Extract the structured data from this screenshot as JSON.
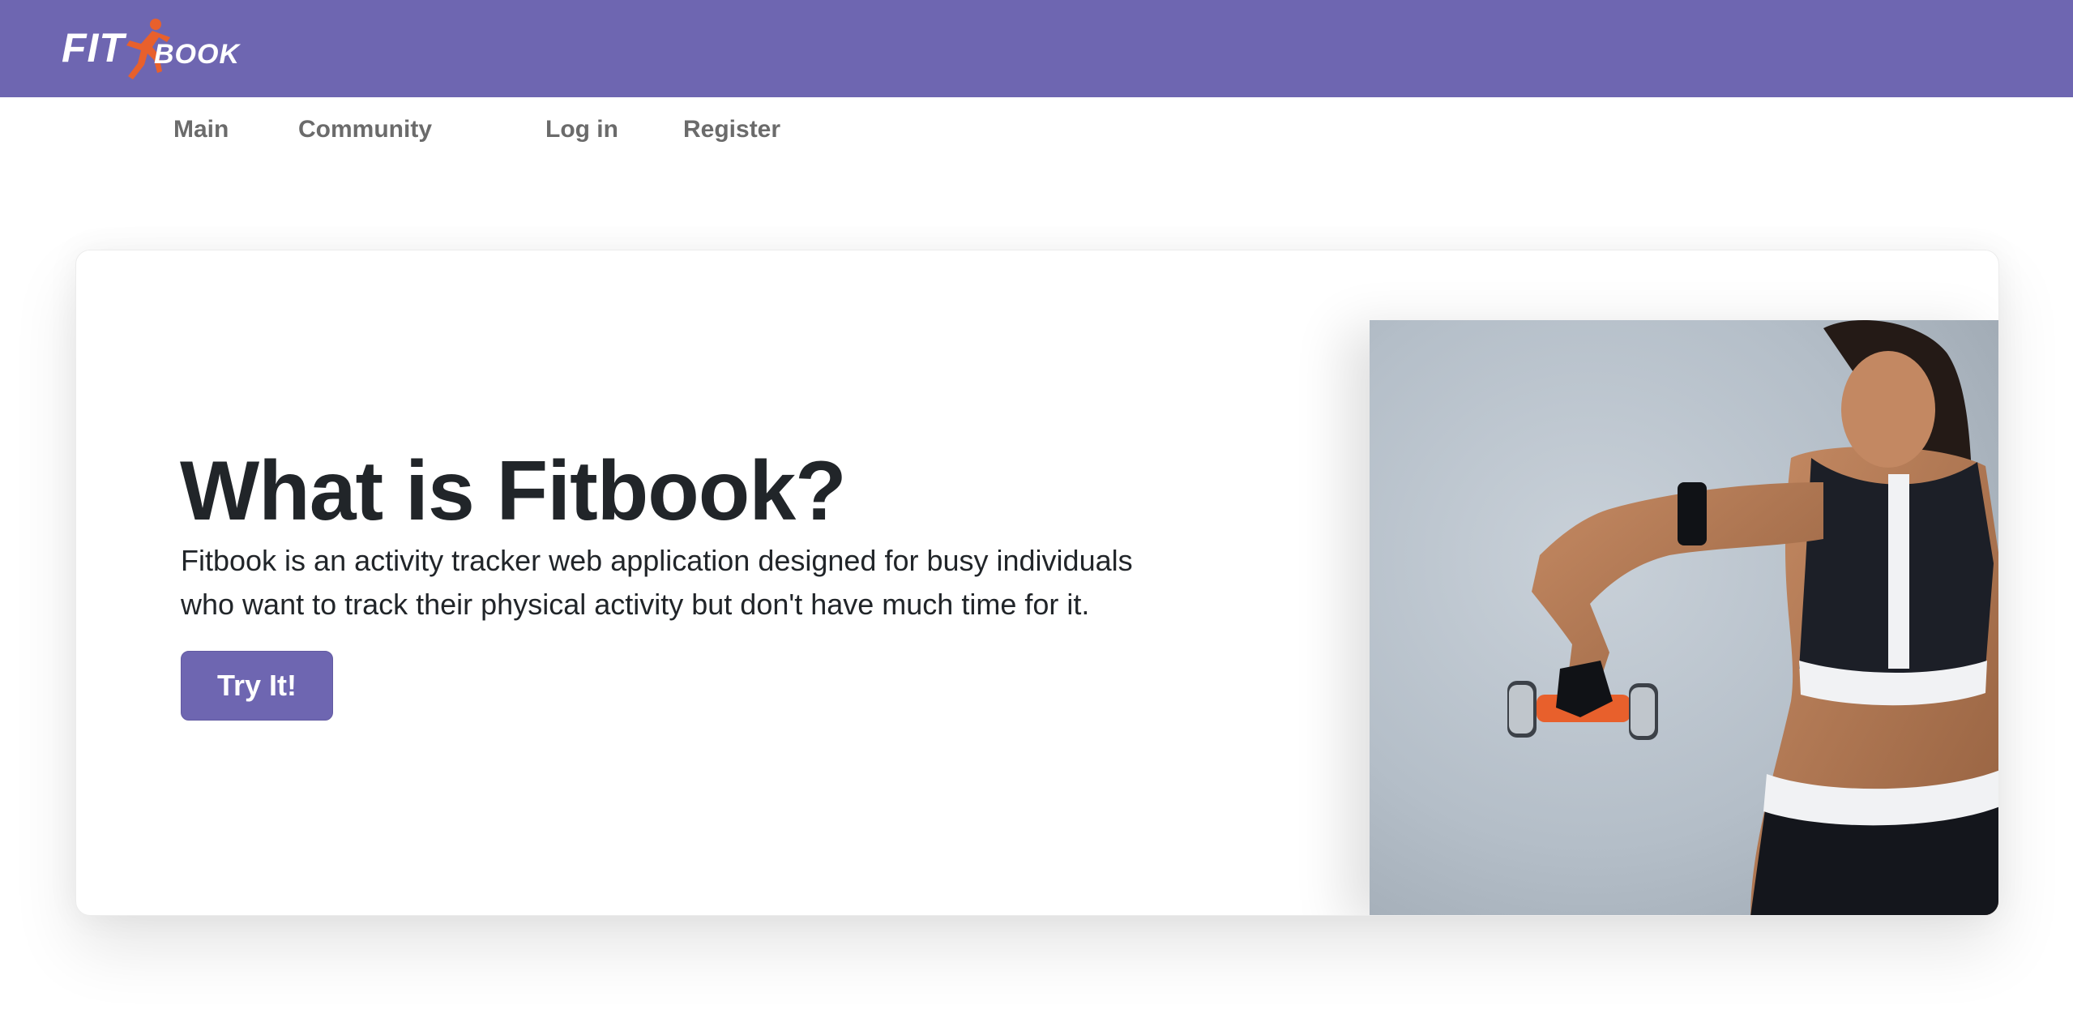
{
  "header": {
    "logo": {
      "part1": "FIT",
      "part2": "BOOK",
      "brand_color": "#6e66b1",
      "accent_color": "#e8602c"
    }
  },
  "nav": {
    "items": [
      {
        "label": "Main"
      },
      {
        "label": "Community"
      },
      {
        "label": "Log in"
      },
      {
        "label": "Register"
      }
    ]
  },
  "hero": {
    "title": "What is Fitbook?",
    "description": "Fitbook is an activity tracker web application designed for busy individuals who want to track their physical activity but don't have much time for it.",
    "cta_label": "Try It!",
    "image_icon": "woman-with-dumbbell-photo"
  }
}
